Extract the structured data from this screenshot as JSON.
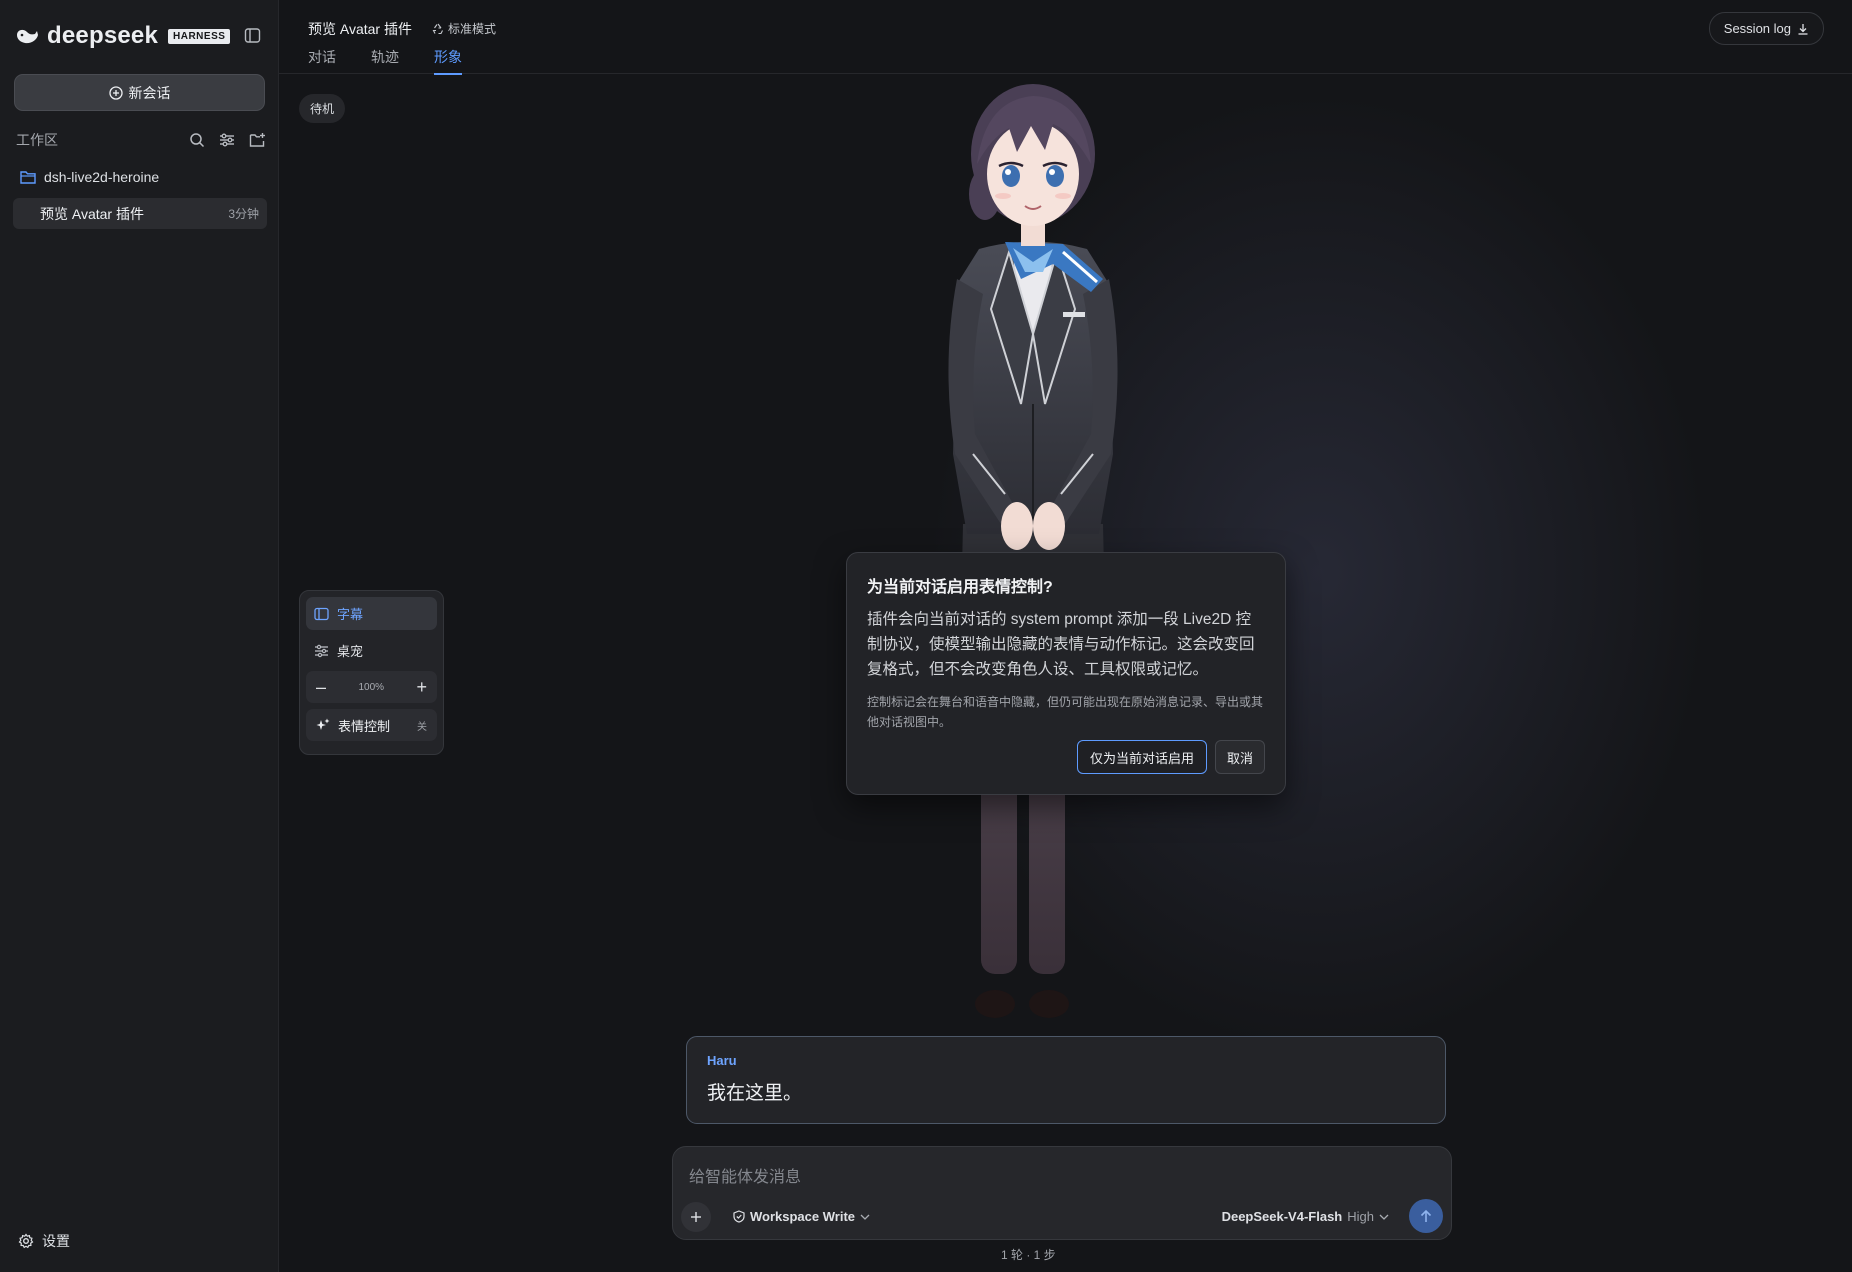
{
  "sidebar": {
    "brand": "deepseek",
    "badge": "HARNESS",
    "new_chat_label": "新会话",
    "workspace_label": "工作区",
    "folder_name": "dsh-live2d-heroine",
    "sessions": [
      {
        "title": "预览 Avatar 插件",
        "age": "3分钟"
      }
    ],
    "settings_label": "设置"
  },
  "header": {
    "title": "预览 Avatar 插件",
    "mode": "标准模式",
    "tabs": [
      {
        "label": "对话",
        "active": false
      },
      {
        "label": "轨迹",
        "active": false
      },
      {
        "label": "形象",
        "active": true
      }
    ],
    "session_log_label": "Session log"
  },
  "stage": {
    "status": "待机"
  },
  "toolpanel": {
    "subtitles_label": "字幕",
    "desktop_label": "桌宠",
    "zoom": "100%",
    "zoom_minus": "–",
    "zoom_plus": "+",
    "expression_label": "表情控制",
    "expression_state": "关"
  },
  "dialog": {
    "title": "为当前对话启用表情控制?",
    "body": "插件会向当前对话的 system prompt 添加一段 Live2D 控制协议，使模型输出隐藏的表情与动作标记。这会改变回复格式，但不会改变角色人设、工具权限或记忆。",
    "note": "控制标记会在舞台和语音中隐藏，但仍可能出现在原始消息记录、导出或其他对话视图中。",
    "confirm_label": "仅为当前对话启用",
    "cancel_label": "取消"
  },
  "subtitle": {
    "speaker": "Haru",
    "text": "我在这里。"
  },
  "composer": {
    "placeholder": "给智能体发消息",
    "permission": "Workspace Write",
    "model": "DeepSeek-V4-Flash",
    "effort": "High"
  },
  "footer": {
    "turns": "1 轮 · 1 步"
  },
  "colors": {
    "accent": "#5e9bff",
    "background": "#141518",
    "sidebar": "#1b1c1f"
  },
  "icons": [
    "whale-logo-icon",
    "sidebar-toggle-icon",
    "plus-circle-icon",
    "search-icon",
    "filter-icon",
    "new-folder-icon",
    "folder-icon",
    "gear-icon",
    "recycle-icon",
    "download-icon",
    "panel-icon",
    "sliders-icon",
    "sparkle-icon",
    "plus-icon",
    "shield-icon",
    "chevron-down-icon",
    "arrow-up-icon"
  ]
}
